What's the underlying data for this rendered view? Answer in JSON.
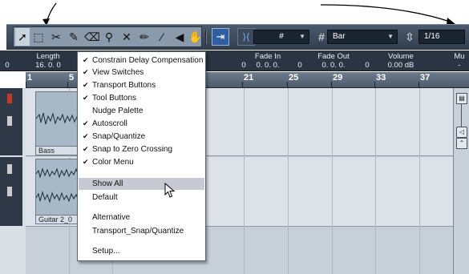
{
  "toolbar": {
    "quantize_symbol": "#",
    "grid_type": "Bar",
    "quantize_value": "1/16",
    "tools": [
      "object-selection",
      "range-selection",
      "split",
      "glue",
      "erase",
      "zoom",
      "mute",
      "draw",
      "line",
      "play",
      "color"
    ]
  },
  "infoline": {
    "length": {
      "label": "Length",
      "value": "16. 0. 0"
    },
    "fade_in": {
      "label": "Fade In",
      "value": "0. 0. 0."
    },
    "fade_out": {
      "label": "Fade Out",
      "value": "0. 0. 0."
    },
    "volume": {
      "label": "Volume",
      "value": "0.00 dB"
    },
    "mute": {
      "label": "Mu",
      "value": "-"
    },
    "left_zero": "0",
    "fade_in_prefix": "0",
    "fade_out_prefix": "0",
    "fade_out_suffix": "0"
  },
  "ruler": {
    "ticks": [
      "1",
      "5",
      "21",
      "25",
      "29",
      "33",
      "37"
    ]
  },
  "tracks": [
    {
      "clip_label": "Bass"
    },
    {
      "clip_label": "Guitar 2_0"
    }
  ],
  "menu": {
    "items": [
      {
        "label": "Constrain Delay Compensation",
        "checked": true
      },
      {
        "label": "View Switches",
        "checked": true
      },
      {
        "label": "Transport Buttons",
        "checked": true
      },
      {
        "label": "Tool Buttons",
        "checked": true
      },
      {
        "label": "Nudge Palette",
        "checked": false
      },
      {
        "label": "Autoscroll",
        "checked": true
      },
      {
        "label": "Snap/Quantize",
        "checked": true
      },
      {
        "label": "Snap to Zero Crossing",
        "checked": true
      },
      {
        "label": "Color Menu",
        "checked": true
      }
    ],
    "show_all": "Show All",
    "default": "Default",
    "alternative": "Alternative",
    "transport_snap": "Transport_Snap/Quantize",
    "setup": "Setup...",
    "check_glyph": "✔"
  },
  "colors": {
    "toolbar": "#3d4b5c",
    "menu_highlight": "#c8c9d2",
    "snap_active": "#2f5fa0"
  }
}
